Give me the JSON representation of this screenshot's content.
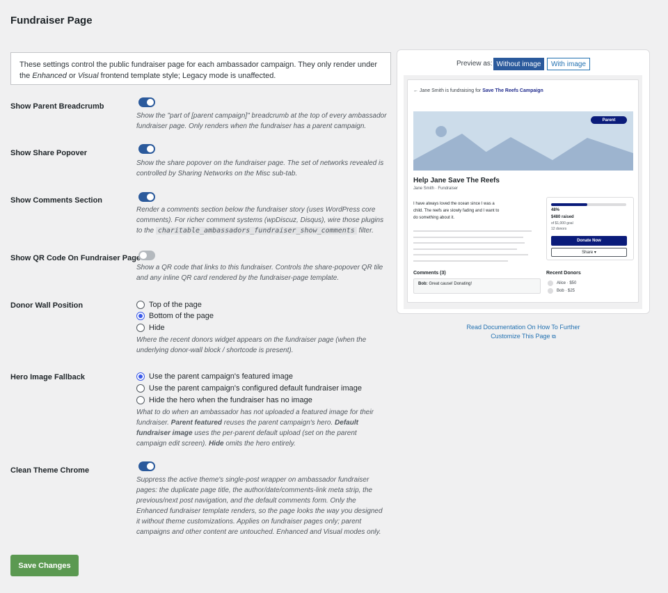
{
  "page": {
    "title": "Fundraiser Page"
  },
  "intro": {
    "part1": "These settings control the public fundraiser page for each ambassador campaign. They only render under the ",
    "enhanced": "Enhanced",
    "or": " or ",
    "visual": "Visual",
    "part2": " frontend template style; Legacy mode is unaffected."
  },
  "settings": {
    "breadcrumb": {
      "label": "Show Parent Breadcrumb",
      "enabled": true,
      "desc": "Show the \"part of [parent campaign]\" breadcrumb at the top of every ambassador fundraiser page. Only renders when the fundraiser has a parent campaign."
    },
    "share": {
      "label": "Show Share Popover",
      "enabled": true,
      "desc": "Show the share popover on the fundraiser page. The set of networks revealed is controlled by Sharing Networks on the Misc sub-tab."
    },
    "comments": {
      "label": "Show Comments Section",
      "enabled": true,
      "desc": "Render a comments section below the fundraiser story (uses WordPress core comments). For richer comment systems (wpDiscuz, Disqus), wire those plugins to the ",
      "code": "charitable_ambassadors_fundraiser_show_comments",
      "desc_end": " filter."
    },
    "qr": {
      "label": "Show QR Code On Fundraiser Page",
      "enabled": false,
      "desc": "Show a QR code that links to this fundraiser. Controls the share-popover QR tile and any inline QR card rendered by the fundraiser-page template."
    },
    "donor_wall": {
      "label": "Donor Wall Position",
      "options": [
        "Top of the page",
        "Bottom of the page",
        "Hide"
      ],
      "selected": "Bottom of the page",
      "desc": "Where the recent donors widget appears on the fundraiser page (when the underlying donor-wall block / shortcode is present)."
    },
    "hero": {
      "label": "Hero Image Fallback",
      "options": [
        "Use the parent campaign's featured image",
        "Use the parent campaign's configured default fundraiser image",
        "Hide the hero when the fundraiser has no image"
      ],
      "selected": "Use the parent campaign's featured image",
      "desc1": "What to do when an ambassador has not uploaded a featured image for their fundraiser. ",
      "b1": "Parent featured",
      "desc2": " reuses the parent campaign's hero. ",
      "b2": "Default fundraiser image",
      "desc3": " uses the per-parent default upload (set on the parent campaign edit screen). ",
      "b3": "Hide",
      "desc4": " omits the hero entirely."
    },
    "clean": {
      "label": "Clean Theme Chrome",
      "enabled": true,
      "desc": "Suppress the active theme's single-post wrapper on ambassador fundraiser pages: the duplicate page title, the author/date/comments-link meta strip, the previous/next post navigation, and the default comments form. Only the Enhanced fundraiser template renders, so the page looks the way you designed it without theme customizations. Applies on fundraiser pages only; parent campaigns and other content are untouched. Enhanced and Visual modes only."
    }
  },
  "save_label": "Save Changes",
  "preview": {
    "preview_as": "Preview as:",
    "btn_without": "Without image",
    "btn_with": "With image",
    "crumb_prefix": "← Jane Smith is fundraising for ",
    "crumb_campaign": "Save The Reefs Campaign",
    "badge": "Parent",
    "title": "Help Jane Save The Reefs",
    "subtitle": "Jane Smith · Fundraiser",
    "story": "I have always loved the ocean since I was a child. The reefs are slowly fading and I want to do something about it.",
    "progress": 0.48,
    "percent": "48%",
    "raised": "$480 raised",
    "goal": "of $1,000 goal",
    "donors_count": "12 donors",
    "donate": "Donate Now",
    "share": "Share ▾",
    "comments_heading": "Comments (3)",
    "comment_author": "Bob:",
    "comment_text": "Great cause! Donating!",
    "recent_heading": "Recent Donors",
    "donors": [
      "Alice · $50",
      "Bob · $25"
    ]
  },
  "doc_link": "Read Documentation On How To Further Customize This Page",
  "colors": {
    "primary": "#2b5a9c",
    "save": "#5b9951",
    "preview_navy": "#0a1b7a"
  }
}
